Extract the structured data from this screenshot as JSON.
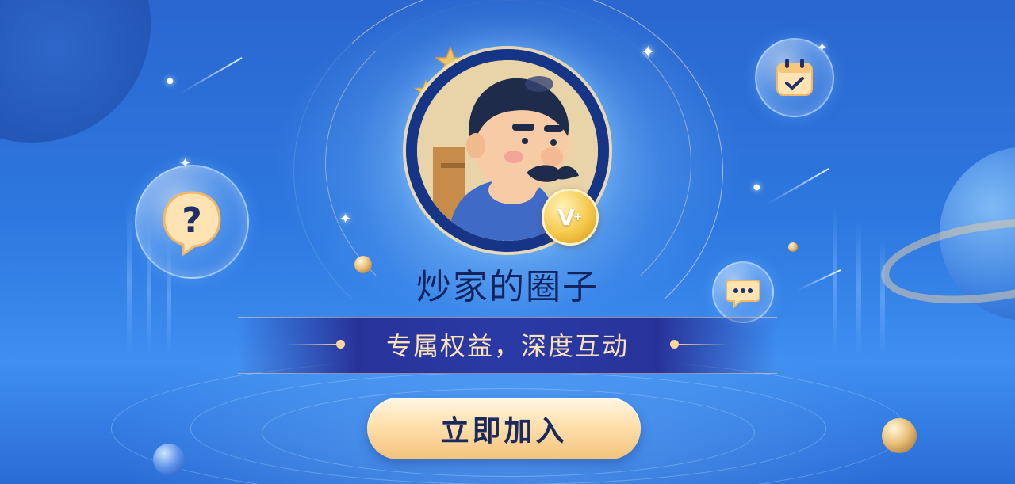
{
  "group": {
    "title": "炒家的圈子",
    "tagline": "专属权益，深度互动",
    "badge_text": "V",
    "badge_plus": "+"
  },
  "actions": {
    "join_label": "立即加入"
  },
  "icons": {
    "help": "question-mark-icon",
    "calendar": "calendar-check-icon",
    "chat": "chat-dots-icon",
    "vip": "vip-badge-icon"
  },
  "colors": {
    "background": "#2d78e0",
    "title": "#12235e",
    "tagline": "#ffe3b8",
    "banner": "#28339a",
    "button": "#ffe0ad",
    "button_text": "#1a2a5c",
    "badge": "#f5c84a"
  }
}
